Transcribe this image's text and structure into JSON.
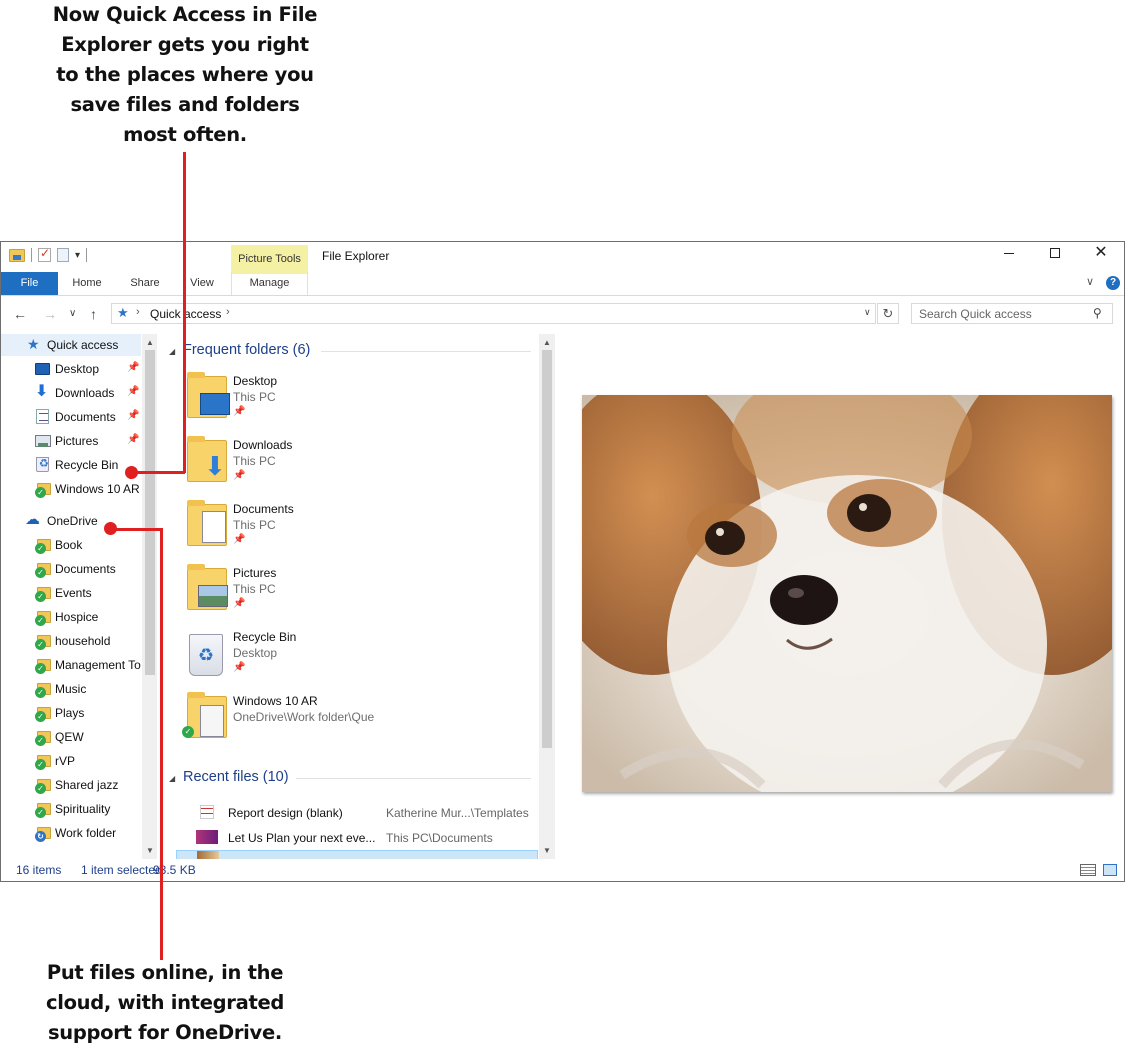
{
  "callouts": {
    "top": [
      "Now Quick Access in File",
      "Explorer gets you right",
      "to the places where you",
      "save files and folders",
      "most often."
    ],
    "bottom": [
      "Put files online, in the",
      "cloud, with integrated",
      "support for OneDrive."
    ]
  },
  "window": {
    "title": "File Explorer",
    "contextual_tab_group": "Picture Tools",
    "tabs": [
      "File",
      "Home",
      "Share",
      "View",
      "Manage"
    ],
    "address": {
      "location": "Quick access",
      "separator": "›"
    },
    "search_placeholder": "Search Quick access"
  },
  "nav_pane": {
    "quick_access_label": "Quick access",
    "quick_access_items": [
      {
        "label": "Desktop",
        "icon": "desktop-icon",
        "pinned": true
      },
      {
        "label": "Downloads",
        "icon": "downloads-icon",
        "pinned": true
      },
      {
        "label": "Documents",
        "icon": "documents-icon",
        "pinned": true
      },
      {
        "label": "Pictures",
        "icon": "pictures-icon",
        "pinned": true
      },
      {
        "label": "Recycle Bin",
        "icon": "recycle-bin-icon",
        "pinned": false
      },
      {
        "label": "Windows 10 AR",
        "icon": "synced-folder-icon",
        "pinned": false
      }
    ],
    "onedrive_label": "OneDrive",
    "onedrive_items": [
      "Book",
      "Documents",
      "Events",
      "Hospice",
      "household",
      "Management To",
      "Music",
      "Plays",
      "QEW",
      "rVP",
      "Shared jazz",
      "Spirituality",
      "Work folder"
    ],
    "pin_glyph": "📌"
  },
  "content": {
    "frequent_header": "Frequent folders (6)",
    "frequent_folders": [
      {
        "name": "Desktop",
        "location": "This PC",
        "pinned": true
      },
      {
        "name": "Downloads",
        "location": "This PC",
        "pinned": true
      },
      {
        "name": "Documents",
        "location": "This PC",
        "pinned": true
      },
      {
        "name": "Pictures",
        "location": "This PC",
        "pinned": true
      },
      {
        "name": "Recycle Bin",
        "location": "Desktop",
        "pinned": true
      },
      {
        "name": "Windows 10 AR",
        "location": "OneDrive\\Work folder\\Que",
        "pinned": false
      }
    ],
    "recent_header": "Recent files (10)",
    "recent_files": [
      {
        "name": "Report design (blank)",
        "path": "Katherine Mur...\\Templates"
      },
      {
        "name": "Let Us Plan your next eve...",
        "path": "This PC\\Documents"
      },
      {
        "name": "",
        "path": ""
      }
    ]
  },
  "status": {
    "item_count": "16 items",
    "selection": "1 item selected",
    "size": "93.5 KB"
  },
  "colors": {
    "accent": "#1e6fc2",
    "callout_red": "#e02020",
    "context_tab": "#f4f0a4",
    "group_header": "#1e3f8a"
  }
}
